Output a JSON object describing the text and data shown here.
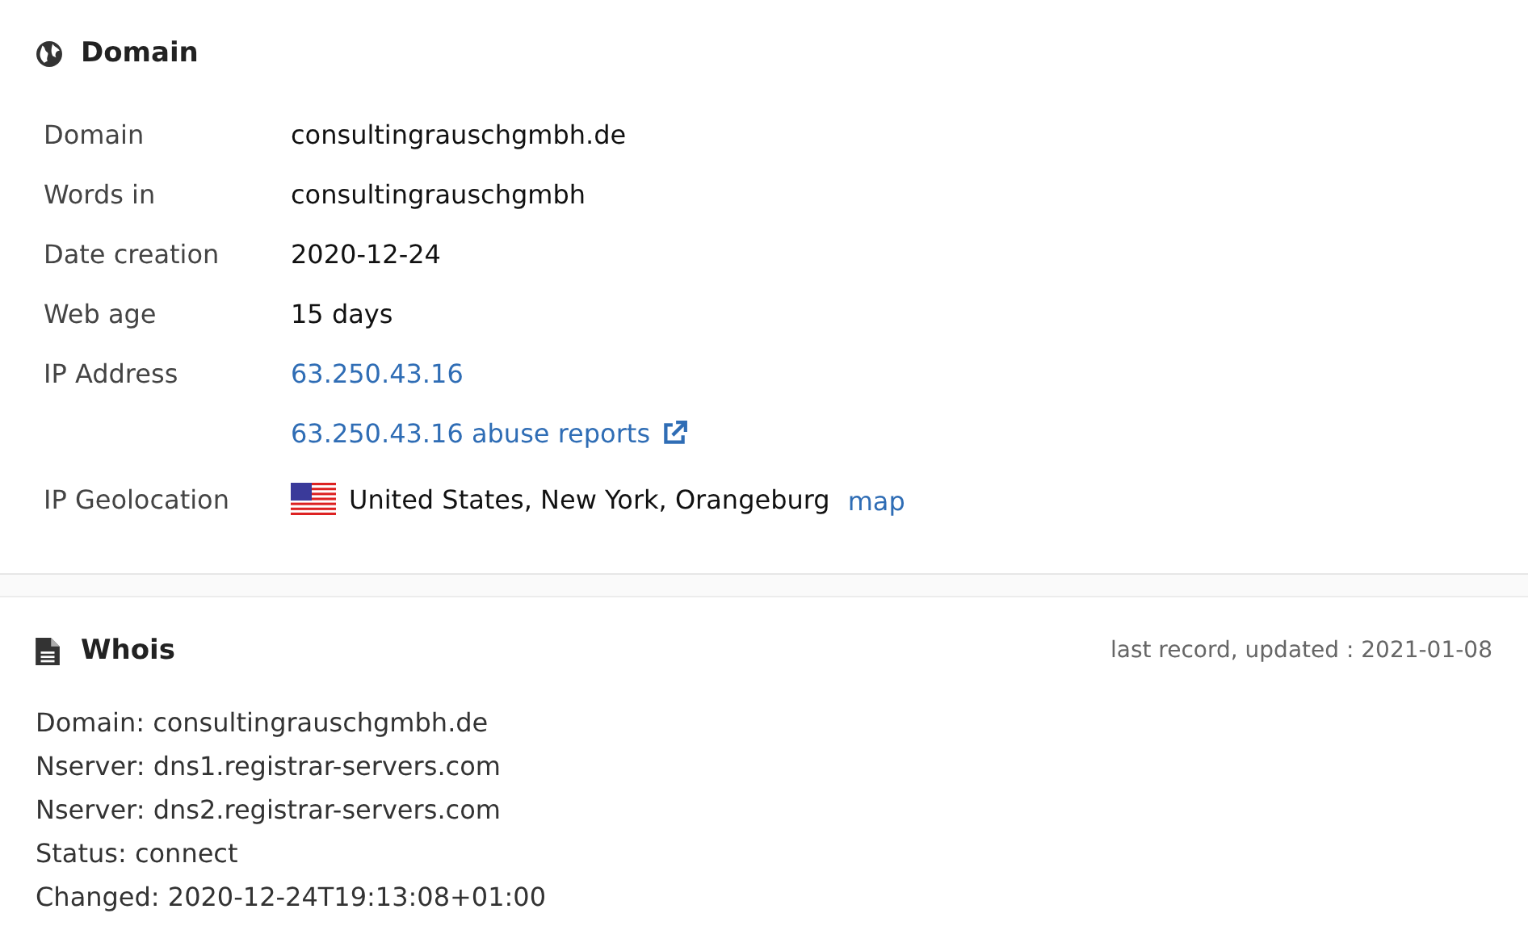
{
  "domain_section": {
    "title": "Domain",
    "rows": [
      {
        "label": "Domain",
        "kind": "text",
        "value": "consultingrauschgmbh.de"
      },
      {
        "label": "Words in",
        "kind": "text",
        "value": "consultingrauschgmbh"
      },
      {
        "label": "Date creation",
        "kind": "text",
        "value": "2020-12-24"
      },
      {
        "label": "Web age",
        "kind": "text",
        "value": "15 days"
      },
      {
        "label": "IP Address",
        "kind": "link",
        "value": "63.250.43.16"
      },
      {
        "kind": "external-link",
        "value": "63.250.43.16 abuse reports"
      },
      {
        "label": "IP Geolocation",
        "kind": "geo",
        "value": "United States, New York, Orangeburg",
        "link": "map"
      }
    ]
  },
  "whois_section": {
    "title": "Whois",
    "updated": "last record, updated : 2021-01-08",
    "lines": [
      "Domain: consultingrauschgmbh.de",
      "Nserver: dns1.registrar-servers.com",
      "Nserver: dns2.registrar-servers.com",
      "Status: connect",
      "Changed: 2020-12-24T19:13:08+01:00"
    ]
  }
}
